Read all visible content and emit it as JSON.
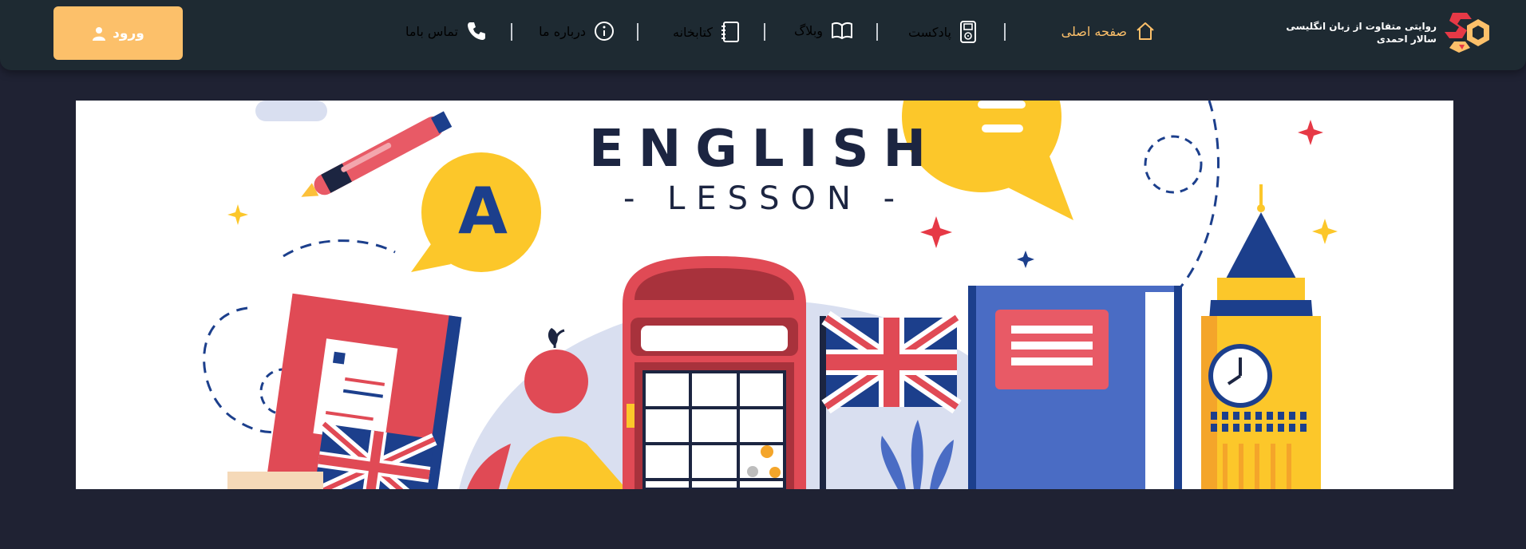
{
  "header": {
    "login_label": "ورود",
    "logo_line1": "روایتی متفاوت از زبان انگلیسی",
    "logo_line2": "سالار احمدی",
    "nav": [
      {
        "label": "صفحه اصلی",
        "icon": "home-icon",
        "active": true
      },
      {
        "label": "پادکست",
        "icon": "ipod-icon",
        "active": false
      },
      {
        "label": "وبلاگ",
        "icon": "book-open-icon",
        "active": false
      },
      {
        "label": "کتابخانه",
        "icon": "notebook-icon",
        "active": false
      },
      {
        "label": "درباره ما",
        "icon": "info-icon",
        "active": false
      },
      {
        "label": "تماس باما",
        "icon": "phone-icon",
        "active": false
      }
    ]
  },
  "banner": {
    "title": "ENGLISH",
    "subtitle": "- LESSON -",
    "bubble_letter": "A"
  },
  "colors": {
    "background": "#1f2233",
    "topbar": "#1e2a32",
    "accent": "#fcc06a",
    "active_nav": "#fcc06a"
  }
}
